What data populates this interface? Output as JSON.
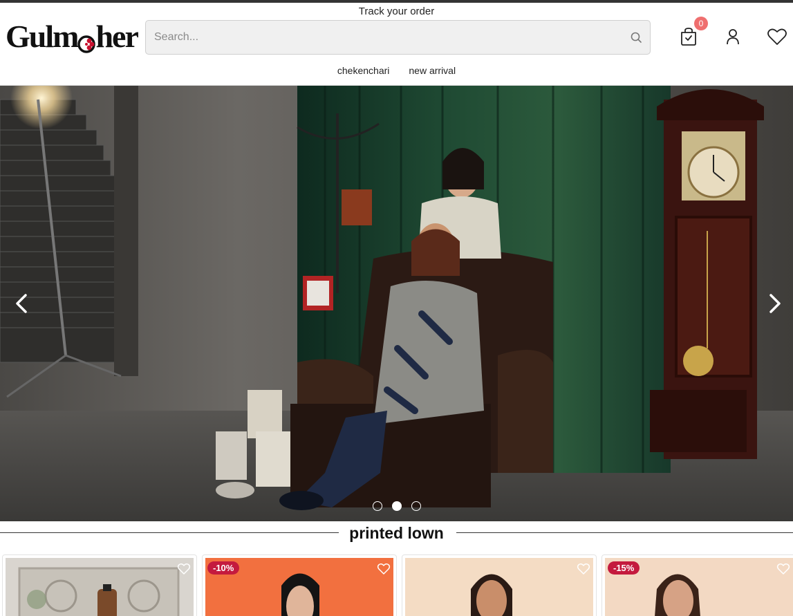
{
  "header": {
    "track_order_label": "Track your order",
    "logo_text_before": "Gulm",
    "logo_text_after": "her",
    "cart_count": "0"
  },
  "search": {
    "placeholder": "Search..."
  },
  "nav": {
    "items": [
      {
        "label": "chekenchari"
      },
      {
        "label": "new arrival"
      }
    ]
  },
  "hero": {
    "slides": 3,
    "active_slide": 2
  },
  "section": {
    "title": "printed lown"
  },
  "products": [
    {
      "discount": ""
    },
    {
      "discount": "-10%"
    },
    {
      "discount": ""
    },
    {
      "discount": "-15%"
    }
  ],
  "colors": {
    "badge": "#c41a3e",
    "cart_count_bg": "#ef6f6f",
    "logo_accent": "#c8102e"
  },
  "icons": {
    "search": "search-icon",
    "cart": "shopping-bag-icon",
    "user": "user-icon",
    "wishlist": "heart-icon",
    "prev": "chevron-left-icon",
    "next": "chevron-right-icon"
  }
}
